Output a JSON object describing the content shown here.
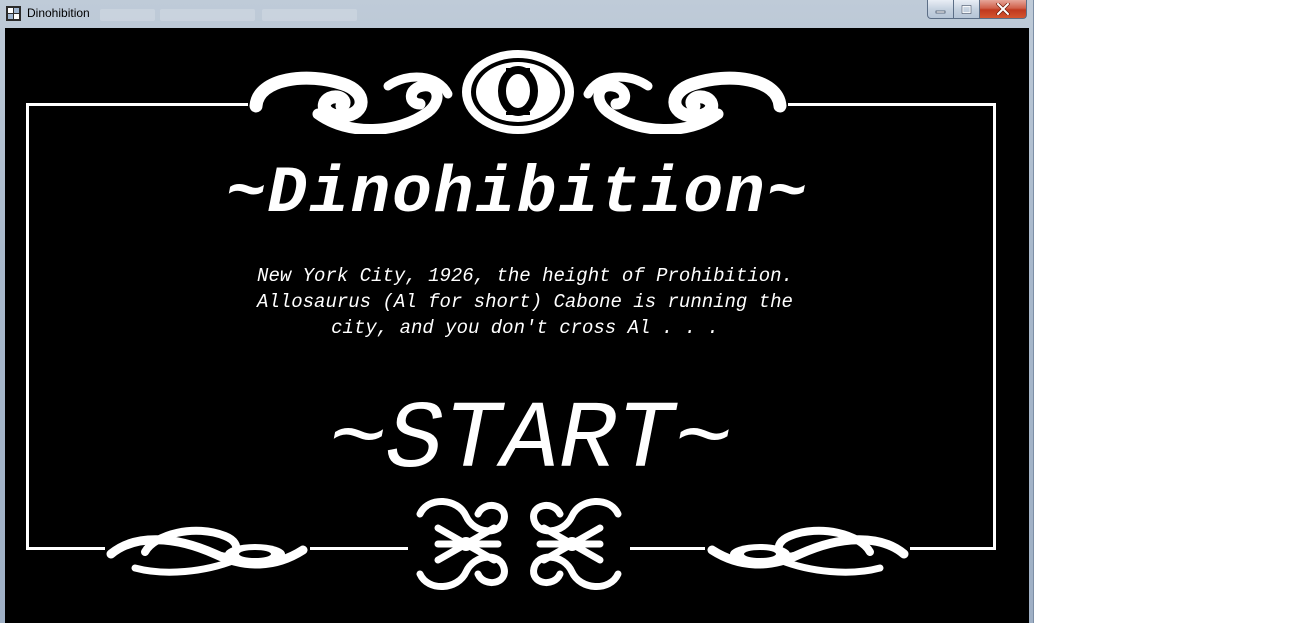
{
  "window": {
    "title": "Dinohibition",
    "icon": "app-icon",
    "controls": {
      "minimize_icon": "minimize-icon",
      "maximize_icon": "maximize-icon",
      "close_icon": "close-icon"
    }
  },
  "game": {
    "title": "~Dinohibition~",
    "intro_lines": [
      "New York City, 1926, the height of Prohibition.",
      "Allosaurus (Al for short) Cabone is running the",
      "city, and you don't cross Al . . ."
    ],
    "start_label": "~START~",
    "colors": {
      "background": "#000000",
      "foreground": "#ffffff"
    }
  }
}
